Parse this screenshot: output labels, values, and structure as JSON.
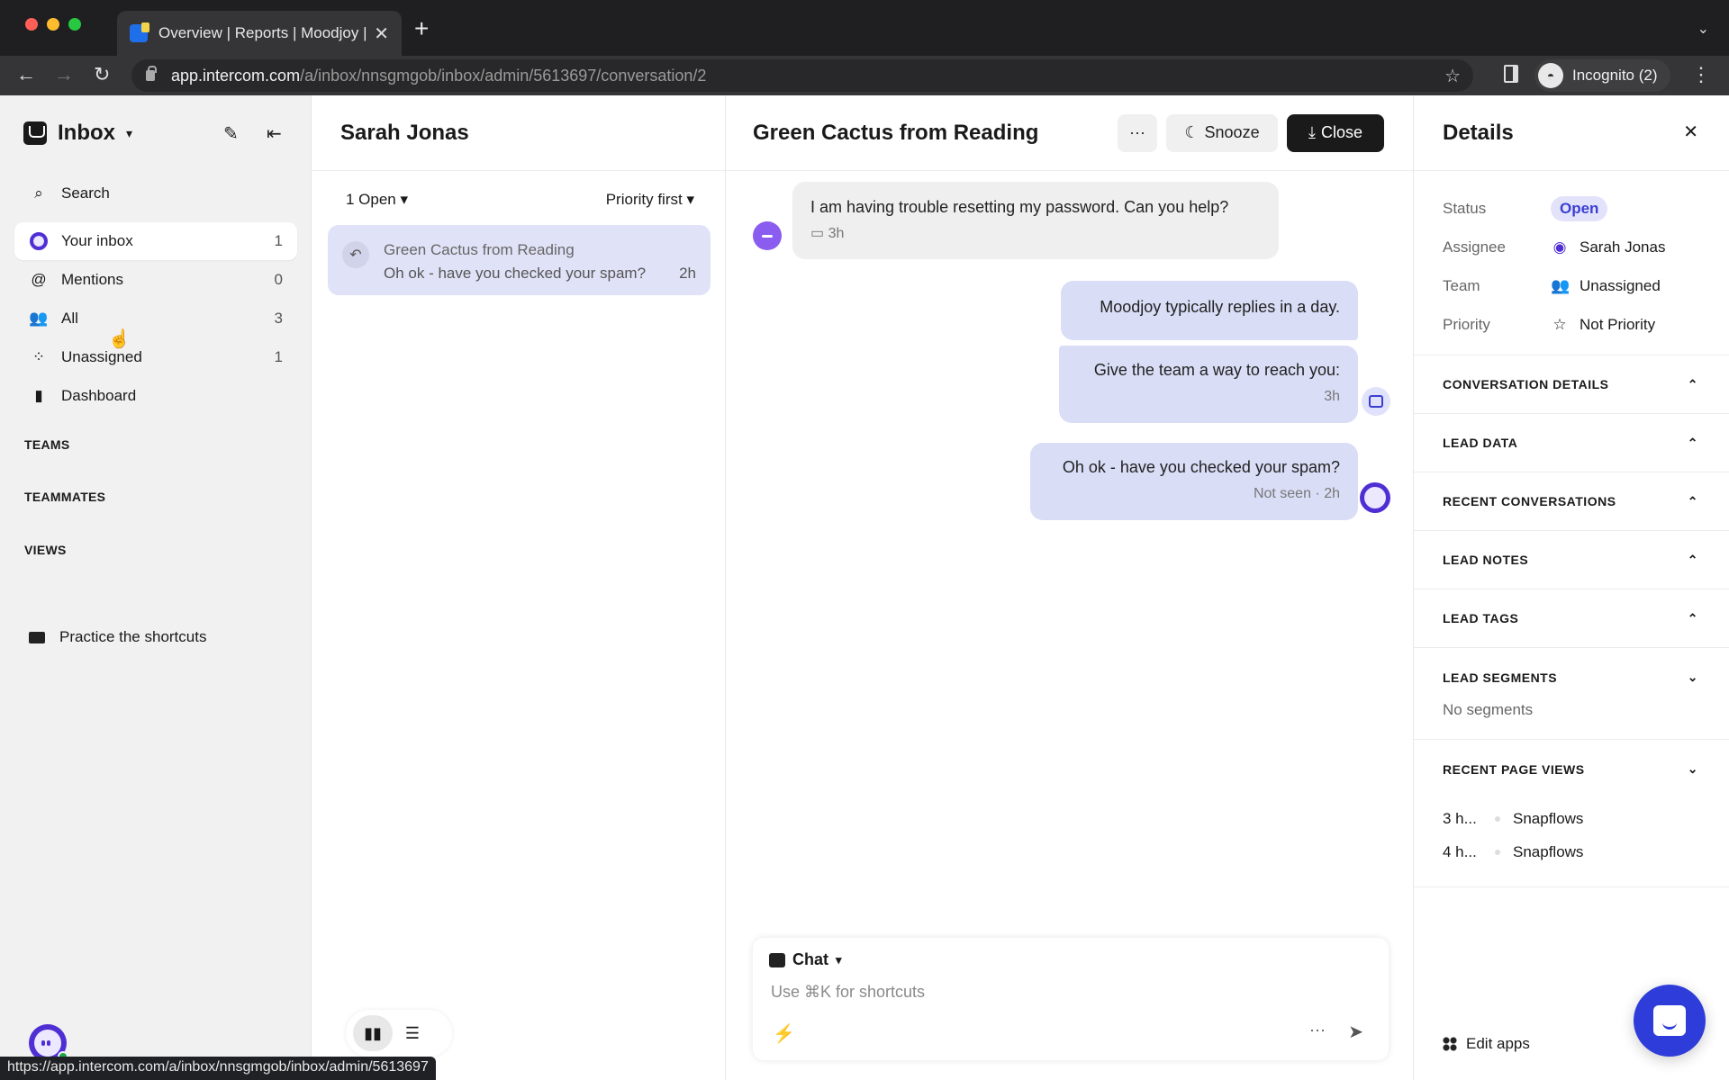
{
  "browser": {
    "tab_title": "Overview | Reports | Moodjoy |",
    "url_host": "app.intercom.com",
    "url_path": "/a/inbox/nnsgmgob/inbox/admin/5613697/conversation/2",
    "profile_label": "Incognito (2)",
    "status_url": "https://app.intercom.com/a/inbox/nnsgmgob/inbox/admin/5613697"
  },
  "sidebar": {
    "title": "Inbox",
    "search_label": "Search",
    "items": [
      {
        "label": "Your inbox",
        "count": "1",
        "icon": "avatar-icon",
        "active": true
      },
      {
        "label": "Mentions",
        "count": "0",
        "icon": "at-icon"
      },
      {
        "label": "All",
        "count": "3",
        "icon": "people-icon"
      },
      {
        "label": "Unassigned",
        "count": "1",
        "icon": "unassigned-icon"
      },
      {
        "label": "Dashboard",
        "count": "",
        "icon": "bar-chart-icon"
      }
    ],
    "sections": [
      "TEAMS",
      "TEAMMATES",
      "VIEWS"
    ],
    "practice_label": "Practice the shortcuts"
  },
  "list": {
    "title": "Sarah Jonas",
    "filter_open": "1 Open",
    "sort": "Priority first",
    "conversations": [
      {
        "name": "Green Cactus from Reading",
        "preview": "Oh ok - have you checked your spam?",
        "time": "2h"
      }
    ]
  },
  "conversation": {
    "title": "Green Cactus from Reading",
    "more_label": "···",
    "snooze_label": "Snooze",
    "close_label": "Close",
    "messages": [
      {
        "text": "I am having trouble resetting my password. Can you help?",
        "meta": "3h",
        "direction": "in"
      },
      {
        "text": "Moodjoy typically replies in a day.",
        "meta": "",
        "direction": "out"
      },
      {
        "text": "Give the team a way to reach you:",
        "meta": "3h",
        "direction": "out"
      },
      {
        "text": "Oh ok - have you checked your spam?",
        "meta": "Not seen · 2h",
        "direction": "out"
      }
    ],
    "composer": {
      "channel": "Chat",
      "placeholder": "Use ⌘K for shortcuts"
    }
  },
  "details": {
    "title": "Details",
    "attributes": [
      {
        "key": "Status",
        "value": "Open"
      },
      {
        "key": "Assignee",
        "value": "Sarah Jonas"
      },
      {
        "key": "Team",
        "value": "Unassigned"
      },
      {
        "key": "Priority",
        "value": "Not Priority"
      }
    ],
    "sections": [
      {
        "label": "CONVERSATION DETAILS",
        "expanded": false
      },
      {
        "label": "LEAD DATA",
        "expanded": false
      },
      {
        "label": "RECENT CONVERSATIONS",
        "expanded": false
      },
      {
        "label": "LEAD NOTES",
        "expanded": false
      },
      {
        "label": "LEAD TAGS",
        "expanded": false
      },
      {
        "label": "LEAD SEGMENTS",
        "expanded": true
      },
      {
        "label": "RECENT PAGE VIEWS",
        "expanded": true
      }
    ],
    "segments_empty": "No segments",
    "page_views": [
      {
        "time": "3 h...",
        "page": "Snapflows"
      },
      {
        "time": "4 h...",
        "page": "Snapflows"
      }
    ],
    "edit_apps_label": "Edit apps"
  },
  "colors": {
    "accent": "#3b3fd1",
    "bubble_out": "#d9ddf6",
    "messenger": "#2e3dd9"
  }
}
